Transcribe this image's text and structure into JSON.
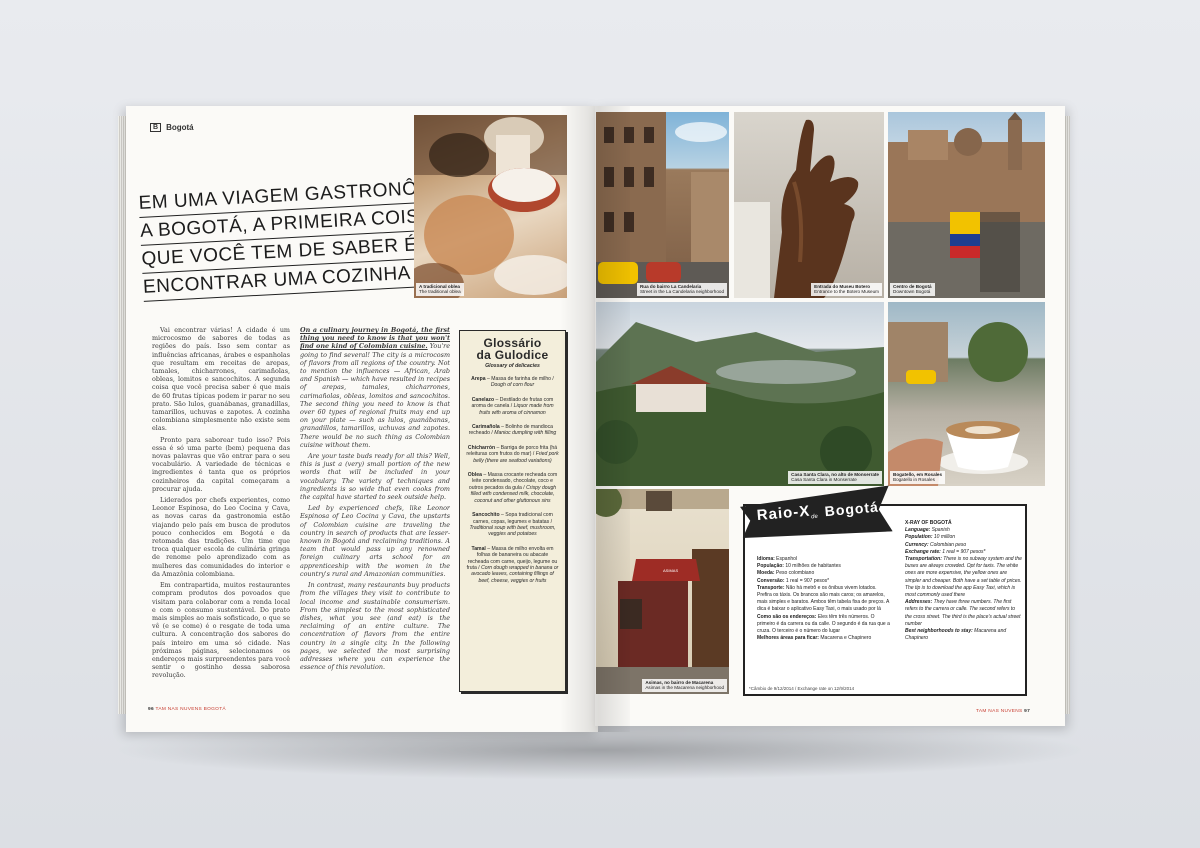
{
  "left_page": {
    "section": "Bogotá",
    "section_page_badge": "B",
    "headline_lines": [
      "Em uma viagem gastronômica",
      "a Bogotá, a primeira coisa",
      "que você tem de saber é que não vai",
      "encontrar uma cozinha colombiana."
    ],
    "photo_caption": {
      "pt": "A tradicional oblea",
      "en": "The traditional oblea"
    },
    "pt_paragraphs": [
      "Vai encontrar várias! A cidade é um microcosmo de sabores de todas as regiões do país. Isso sem contar as influências africanas, árabes e espanholas que resultam em receitas de arepas, tamales, chicharrones, carimañolas, obleas, lomitos e sancochitos. A segunda coisa que você precisa saber é que mais de 60 frutas típicas podem ir parar no seu prato. São lulos, guanábanas, granadillas, tamarillos, uchuvas e zapotes. A cozinha colombiana simplesmente não existe sem elas.",
      "Pronto para saborear tudo isso? Pois essa é só uma parte (bem) pequena das novas palavras que vão entrar para o seu vocabulário. A variedade de técnicas e ingredientes é tanta que os próprios cozinheiros da capital começaram a procurar ajuda.",
      "Liderados por chefs experientes, como Leonor Espinosa, do Leo Cocina y Cava, as novas caras da gastronomia estão viajando pelo país em busca de produtos pouco conhecidos em Bogotá e da retomada das tradições. Um time que troca qualquer escola de culinária gringa de renome pelo aprendizado com as mulheres das comunidades do interior e da Amazônia colombiana.",
      "Em contrapartida, muitos restaurantes compram produtos dos povoados que visitam para colaborar com a renda local e com o consumo sustentável. Do prato mais simples ao mais sofisticado, o que se vê (e se come) é o resgate de toda uma cultura. A concentração dos sabores do país inteiro em uma só cidade. Nas próximas páginas, selecionamos os endereços mais surpreendentes para você sentir o gostinho dessa saborosa revolução."
    ],
    "en_lead": "On a culinary journey in Bogotá, the first thing you need to know is that you won't find one kind of Colombian cuisine.",
    "en_paragraphs": [
      "You're going to find several! The city is a microcosm of flavors from all regions of the country. Not to mention the influences — African, Arab and Spanish — which have resulted in recipes of arepas, tamales, chicharrones, carimañolas, obleas, lomitos and sancochitos. The second thing you need to know is that over 60 types of regional fruits may end up on your plate — such as lulos, guanábanas, granadillos, tamarillos, uchuvas and zapotes. There would be no such thing as Colombian cuisine without them.",
      "Are your taste buds ready for all this? Well, this is just a (very) small portion of the new words that will be included in your vocabulary. The variety of techniques and ingredients is so wide that even cooks from the capital have started to seek outside help.",
      "Led by experienced chefs, like Leonor Espinosa of Leo Cocina y Cava, the upstarts of Colombian cuisine are traveling the country in search of products that are lesser-known in Bogotá and reclaiming traditions. A team that would pass up any renowned foreign culinary arts school for an apprenticeship with the women in the country's rural and Amazonian communities.",
      "In contrast, many restaurants buy products from the villages they visit to contribute to local income and sustainable consumerism. From the simplest to the most sophisticated dishes, what you see (and eat) is the reclaiming of an entire culture. The concentration of flavors from the entire country in a single city. In the following pages, we selected the most surprising addresses where you can experience the essence of this revolution."
    ],
    "glossary": {
      "title_line1": "Glossário",
      "title_line2": "da Gulodice",
      "subtitle": "Glossary of delicacies",
      "items": [
        {
          "term": "Arepa",
          "pt": "Massa de farinha de milho",
          "en": "Dough of corn flour"
        },
        {
          "term": "Canelazo",
          "pt": "Destilado de frutas com aroma de canela",
          "en": "Liquor made from fruits with aroma of cinnamon"
        },
        {
          "term": "Carimañola",
          "pt": "Bolinho de mandioca recheado",
          "en": "Manioc dumpling with filling"
        },
        {
          "term": "Chicharrón",
          "pt": "Barriga de porco frita (há releituras com frutos do mar)",
          "en": "Fried pork belly (there are seafood variations)"
        },
        {
          "term": "Oblea",
          "pt": "Massa crocante recheada com leite condensado, chocolate, coco e outros pecados da gula",
          "en": "Crispy dough filled with condensed milk, chocolate, coconut and other gluttonous sins"
        },
        {
          "term": "Sancochito",
          "pt": "Sopa tradicional com carnes, copas, legumes e batatas",
          "en": "Traditional soup with beef, mushroom, veggies and potatoes"
        },
        {
          "term": "Tamal",
          "pt": "Massa de milho envolta em folhas de bananeira ou abacate recheada com carne, queijo, legume ou fruta",
          "en": "Corn dough wrapped in banana or avocado leaves, containing fillings of beef, cheese, veggies or fruits"
        }
      ]
    },
    "folio": {
      "number": "96",
      "text": "TAM NAS NUVENS BOGOTÁ"
    }
  },
  "right_page": {
    "photos": [
      {
        "pt": "Rua do bairro La Candelaria",
        "en": "Street in the La Candelaria neighborhood"
      },
      {
        "pt": "Entrada do Museu Botero",
        "en": "Entrance to the Botero Museum"
      },
      {
        "pt": "Centro de Bogotá",
        "en": "Downtown Bogotá"
      },
      {
        "pt": "Casa Santa Clara, no alto de Monserrate",
        "en": "Casa Santa Clara in Monserrate"
      },
      {
        "pt": "Bogatello, em Rosales",
        "en": "Bogatello in Rosales"
      },
      {
        "pt": "Asimas, no bairro de Macarena",
        "en": "Asimas in the Macarena neighborhood"
      }
    ],
    "restaurant_sign": "ASIMAS",
    "raio_x": {
      "title1": "Raio-X",
      "de": "de",
      "title2": "Bogotá",
      "pt": [
        {
          "k": "Idioma:",
          "v": "Espanhol"
        },
        {
          "k": "População:",
          "v": "10 milhões de habitantes"
        },
        {
          "k": "Moeda:",
          "v": "Peso colombiano"
        },
        {
          "k": "Conversão:",
          "v": "1 real = 907 pesos*"
        },
        {
          "k": "Transporte:",
          "v": "Não há metrô e os ônibus vivem lotados. Prefira os táxis. Os brancos são mais caros; os amarelos, mais simples e baratos. Ambos têm tabela fixa de preços. A dica é baixar o aplicativo Easy Taxi, o mais usado por lá"
        },
        {
          "k": "Como são os endereços:",
          "v": "Eles têm três números. O primeiro é da carrera ou da calle. O segundo é da rua que a cruza. O terceiro é o número do lugar"
        },
        {
          "k": "Melhores áreas para ficar:",
          "v": "Macarena e Chapinero"
        }
      ],
      "en_title": "X-RAY OF BOGOTÁ",
      "en": [
        {
          "k": "Language:",
          "v": "Spanish"
        },
        {
          "k": "Population:",
          "v": "10 million"
        },
        {
          "k": "Currency:",
          "v": "Colombian peso"
        },
        {
          "k": "Exchange rate:",
          "v": "1 real = 907 pesos*"
        },
        {
          "k": "Transportation:",
          "v": "There is no subway system and the buses are always crowded. Opt for taxis. The white ones are more expensive, the yellow ones are simpler and cheaper. Both have a set table of prices. The tip is to download the app Easy Taxi, which is most commonly used there"
        },
        {
          "k": "Addresses:",
          "v": "They have three numbers. The first refers to the carrera or calle. The second refers to the cross street. The third is the place's actual street number"
        },
        {
          "k": "Best neighborhoods to stay:",
          "v": "Macarena and Chapinero"
        }
      ],
      "footnote": "*Câmbio de 9/12/2014 / Exchange rate on 12/9/2014"
    },
    "folio": {
      "number": "97",
      "text": "TAM NAS NUVENS"
    }
  },
  "colors": {
    "accent": "#c73a2e",
    "flag_yellow": "#f2c200",
    "flag_blue": "#1f3e8f",
    "flag_red": "#c92a2a",
    "glossary_bg": "#f3eedb"
  }
}
